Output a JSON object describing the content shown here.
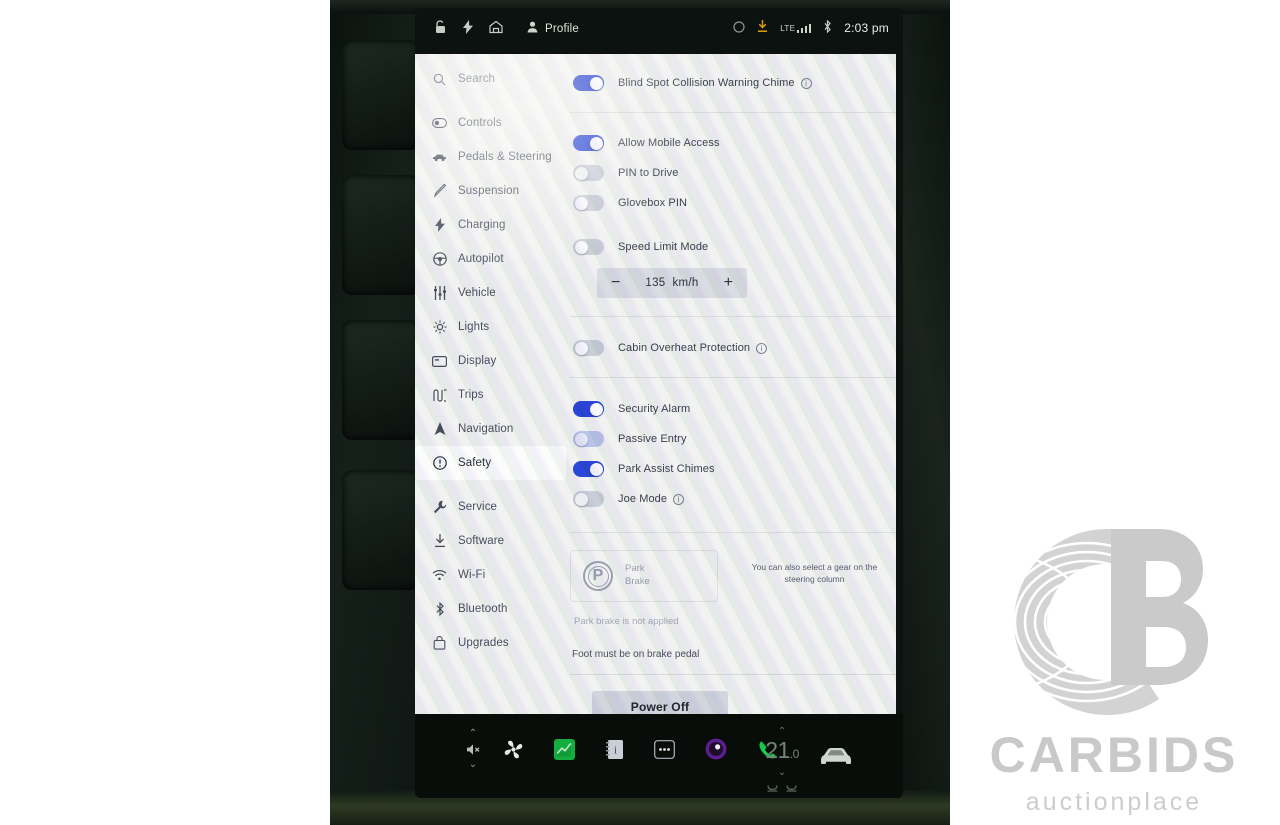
{
  "statusbar": {
    "icons_left": [
      "unlock-icon",
      "bolt-icon",
      "garage-home-icon"
    ],
    "profile_label": "Profile",
    "icons_right": [
      "circle-icon",
      "download-icon"
    ],
    "network_label": "LTE",
    "bluetooth_icon": "bluetooth-icon",
    "clock": "2:03 pm"
  },
  "sidebar": {
    "search_placeholder": "Search",
    "items": [
      {
        "label": "Controls",
        "icon": "toggle-icon"
      },
      {
        "label": "Pedals & Steering",
        "icon": "car-side-icon"
      },
      {
        "label": "Suspension",
        "icon": "suspension-icon"
      },
      {
        "label": "Charging",
        "icon": "bolt-icon"
      },
      {
        "label": "Autopilot",
        "icon": "steering-wheel-icon"
      },
      {
        "label": "Vehicle",
        "icon": "sliders-icon"
      },
      {
        "label": "Lights",
        "icon": "light-icon"
      },
      {
        "label": "Display",
        "icon": "display-icon"
      },
      {
        "label": "Trips",
        "icon": "trips-icon"
      },
      {
        "label": "Navigation",
        "icon": "navigation-arrow-icon"
      },
      {
        "label": "Safety",
        "icon": "warning-circle-icon",
        "selected": true
      },
      {
        "label": "Service",
        "icon": "wrench-icon"
      },
      {
        "label": "Software",
        "icon": "download-icon"
      },
      {
        "label": "Wi-Fi",
        "icon": "wifi-icon"
      },
      {
        "label": "Bluetooth",
        "icon": "bluetooth-icon"
      },
      {
        "label": "Upgrades",
        "icon": "bag-icon"
      }
    ]
  },
  "settings": {
    "rows": [
      {
        "label": "Blind Spot Collision Warning Chime",
        "state": "on",
        "info": true
      },
      {
        "label": "Allow Mobile Access",
        "state": "on",
        "info": false
      },
      {
        "label": "PIN to Drive",
        "state": "off",
        "info": false
      },
      {
        "label": "Glovebox PIN",
        "state": "off",
        "info": false
      },
      {
        "label": "Speed Limit Mode",
        "state": "off",
        "info": false
      },
      {
        "label": "Cabin Overheat Protection",
        "state": "off",
        "info": true
      },
      {
        "label": "Security Alarm",
        "state": "on",
        "info": false
      },
      {
        "label": "Passive Entry",
        "state": "dim",
        "info": false
      },
      {
        "label": "Park Assist Chimes",
        "state": "on",
        "info": false
      },
      {
        "label": "Joe Mode",
        "state": "off",
        "info": true
      }
    ],
    "speed_limit": {
      "minus": "−",
      "value": "135",
      "unit": "km/h",
      "plus": "+"
    }
  },
  "park_brake": {
    "badge": "P",
    "title_line1": "Park",
    "title_line2": "Brake",
    "note": "You can also select a gear on the steering column",
    "status": "Park brake is not applied",
    "requirement": "Foot must be on brake pedal",
    "power_off_label": "Power Off"
  },
  "dock": {
    "volume_icon": "volume-mute-icon",
    "chevron_up": "⌃",
    "chevron_down": "⌄",
    "apps": [
      {
        "name": "fan-icon"
      },
      {
        "name": "energy-app-icon"
      },
      {
        "name": "notes-app-icon"
      },
      {
        "name": "more-dots-icon"
      },
      {
        "name": "media-app-icon"
      },
      {
        "name": "phone-icon"
      }
    ],
    "temperature": "21",
    "temperature_decimal": ".0",
    "seat_heater_icons": [
      "seat-left-icon",
      "seat-right-icon"
    ],
    "car_icon": "car-front-icon"
  },
  "watermark": {
    "logo": "cb-fingerprint-logo",
    "title": "CARBIDS",
    "subtitle": "auctionplace"
  },
  "colors": {
    "toggle_on": "#2b46d8",
    "toggle_off": "#c9cdd8",
    "toggle_dim": "#b9c2e8",
    "panel_bg": "#f2f2f2",
    "dock_bg": "#080d0a",
    "accent_download": "#e8a317"
  }
}
